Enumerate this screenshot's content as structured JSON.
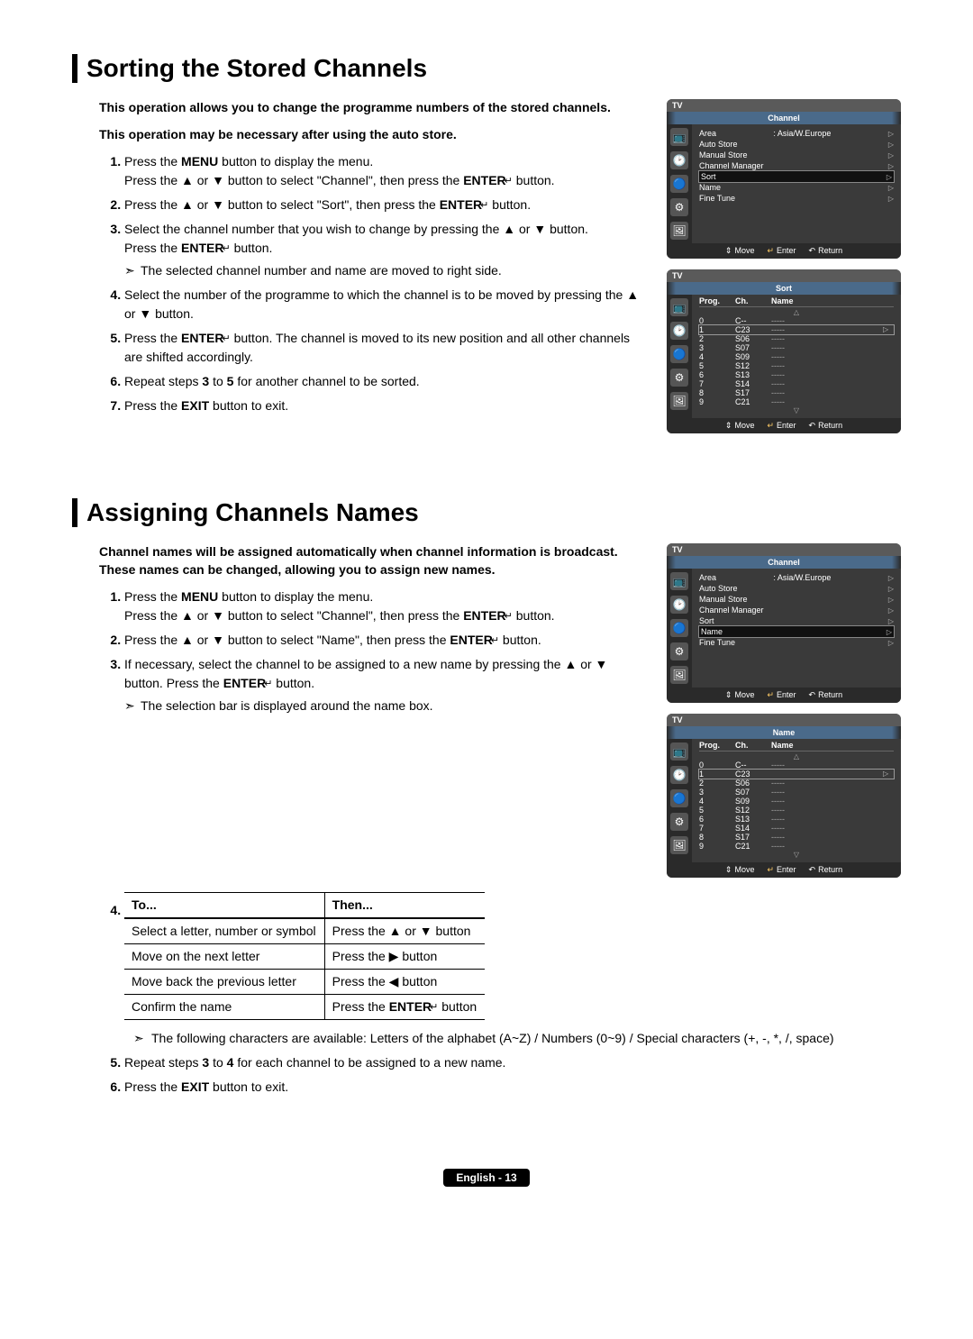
{
  "section1": {
    "title": "Sorting the Stored Channels",
    "intro1": "This operation allows you to change the programme numbers of the stored channels.",
    "intro2": "This operation may be necessary after using the auto store.",
    "steps": [
      {
        "pre": "Press the ",
        "b1": "MENU",
        "mid1": " button to display the menu.\nPress the ▲ or ▼ button to select \"Channel\", then press the ",
        "b2": "ENTER",
        "icon": "↵",
        "tail": " button."
      },
      {
        "pre": "Press the ▲ or ▼ button to select \"Sort\", then press the ",
        "b1": "ENTER",
        "icon": "↵",
        "tail": " button."
      },
      {
        "pre": "Select the channel number that you wish to change by pressing the ▲ or ▼ button.\nPress the ",
        "b1": "ENTER",
        "icon": "↵",
        "tail": " button.",
        "note": "The selected channel number and name are moved to right side."
      },
      {
        "pre": "Select the number of the programme to which the channel is to be moved by pressing the ▲ or ▼ button."
      },
      {
        "pre": "Press the ",
        "b1": "ENTER",
        "icon": "↵",
        "tail": " button. The channel is moved to its new position and all other channels are shifted accordingly."
      },
      {
        "pre": "Repeat steps ",
        "b1": "3",
        "mid1": " to ",
        "b2": "5",
        "tail": " for another channel to be sorted."
      },
      {
        "pre": "Press the ",
        "b1": "EXIT",
        "tail": " button to exit."
      }
    ]
  },
  "section2": {
    "title": "Assigning Channels Names",
    "intro": "Channel names will be assigned automatically when channel information is broadcast. These names can be changed, allowing you to assign new names.",
    "steps_a": [
      {
        "pre": "Press the ",
        "b1": "MENU",
        "mid1": " button to display the menu.\nPress the ▲ or ▼ button to select \"Channel\", then press the ",
        "b2": "ENTER",
        "icon": "↵",
        "tail": " button."
      },
      {
        "pre": "Press the ▲ or ▼ button to select \"Name\", then press the ",
        "b1": "ENTER",
        "icon": "↵",
        "tail": " button."
      },
      {
        "pre": "If necessary, select the channel to be assigned to a new name by pressing the ▲ or ▼ button. Press the ",
        "b1": "ENTER",
        "icon": "↵",
        "tail": " button.",
        "note": "The selection bar is displayed around the name box."
      }
    ],
    "table": {
      "head": {
        "to": "To...",
        "then": "Then..."
      },
      "rows": [
        {
          "to": "Select a letter, number or symbol",
          "then": "Press the ▲ or ▼ button"
        },
        {
          "to": "Move on the next letter",
          "then": "Press the ▶ button"
        },
        {
          "to": "Move back the previous letter",
          "then": "Press the ◀ button"
        },
        {
          "to": "Confirm the name",
          "then_pre": "Press the ",
          "then_b": "ENTER",
          "then_icon": "↵",
          "then_tail": " button"
        }
      ]
    },
    "chars_note": "The following characters are available: Letters of the alphabet (A~Z) / Numbers (0~9) / Special characters (+, -, *, /, space)",
    "steps_b": [
      {
        "pre": "Repeat steps ",
        "b1": "3",
        "mid1": " to ",
        "b2": "4",
        "tail": " for each channel to be assigned to a new name."
      },
      {
        "pre": "Press the ",
        "b1": "EXIT",
        "tail": " button to exit."
      }
    ]
  },
  "osd": {
    "tv": "TV",
    "channel_title": "Channel",
    "sort_title": "Sort",
    "name_title": "Name",
    "footer": {
      "move": "Move",
      "enter": "Enter",
      "ret": "Return"
    },
    "area_label": "Area",
    "area_value": ": Asia/W.Europe",
    "menu_items": [
      "Auto Store",
      "Manual Store",
      "Channel Manager",
      "Sort",
      "Name",
      "Fine Tune"
    ],
    "highlight_sort": "Sort",
    "highlight_name": "Name",
    "sort_head": {
      "prog": "Prog.",
      "ch": "Ch.",
      "name": "Name"
    },
    "sort_rows": [
      {
        "p": "0",
        "ch": "C--",
        "name": "-----"
      },
      {
        "p": "1",
        "ch": "C23",
        "name": "-----",
        "hl": true
      },
      {
        "p": "2",
        "ch": "S06",
        "name": "-----"
      },
      {
        "p": "3",
        "ch": "S07",
        "name": "-----"
      },
      {
        "p": "4",
        "ch": "S09",
        "name": "-----"
      },
      {
        "p": "5",
        "ch": "S12",
        "name": "-----"
      },
      {
        "p": "6",
        "ch": "S13",
        "name": "-----"
      },
      {
        "p": "7",
        "ch": "S14",
        "name": "-----"
      },
      {
        "p": "8",
        "ch": "S17",
        "name": "-----"
      },
      {
        "p": "9",
        "ch": "C21",
        "name": "-----"
      }
    ],
    "name_rows": [
      {
        "p": "0",
        "ch": "C--",
        "name": "-----"
      },
      {
        "p": "1",
        "ch": "C23",
        "name": "",
        "hl": true
      },
      {
        "p": "2",
        "ch": "S06",
        "name": "-----"
      },
      {
        "p": "3",
        "ch": "S07",
        "name": "-----"
      },
      {
        "p": "4",
        "ch": "S09",
        "name": "-----"
      },
      {
        "p": "5",
        "ch": "S12",
        "name": "-----"
      },
      {
        "p": "6",
        "ch": "S13",
        "name": "-----"
      },
      {
        "p": "7",
        "ch": "S14",
        "name": "-----"
      },
      {
        "p": "8",
        "ch": "S17",
        "name": "-----"
      },
      {
        "p": "9",
        "ch": "C21",
        "name": "-----"
      }
    ],
    "icon_glyphs": [
      "📺",
      "🕑",
      "🔵",
      "⚙",
      "🖼"
    ]
  },
  "footer": "English - 13"
}
